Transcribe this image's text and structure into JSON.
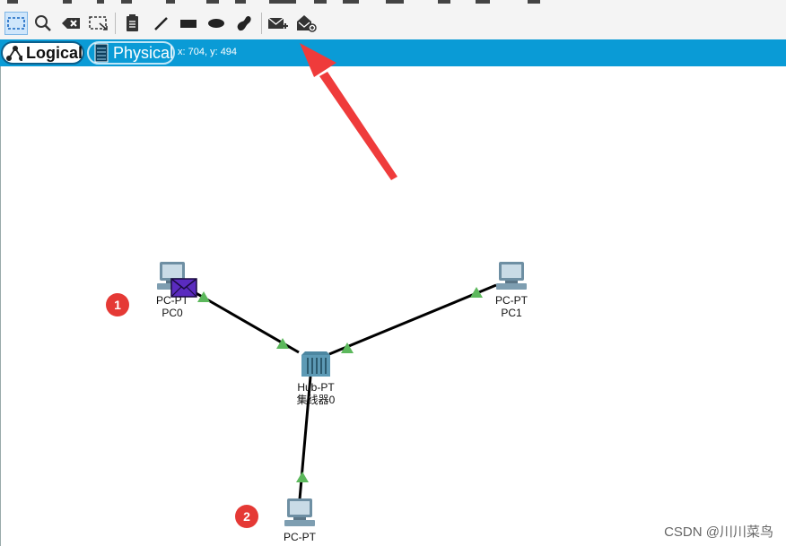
{
  "toolbar": {
    "tools": [
      "select-icon",
      "inspect-icon",
      "delete-icon",
      "resize-icon",
      "note-icon",
      "line-icon",
      "rectangle-icon",
      "ellipse-icon",
      "freeform-icon",
      "add-simple-pdu-icon",
      "add-complex-pdu-icon"
    ]
  },
  "tabs": {
    "logical": "Logical",
    "physical": "Physical"
  },
  "coords": "x: 704, y: 494",
  "devices": {
    "pc0": {
      "type": "PC-PT",
      "name": "PC0"
    },
    "pc1": {
      "type": "PC-PT",
      "name": "PC1"
    },
    "hub": {
      "type": "Hub-PT",
      "name": "集线器0"
    },
    "pc2": {
      "type": "PC-PT"
    }
  },
  "badges": {
    "one": "1",
    "two": "2"
  },
  "watermark": "CSDN @川川菜鸟",
  "colors": {
    "tabbar": "#0a9bd6",
    "link": "#000000",
    "link_up": "#5cb85c",
    "arrow": "#ef3b3b",
    "pdu": "#5a2bbf",
    "badge": "#e53935"
  }
}
